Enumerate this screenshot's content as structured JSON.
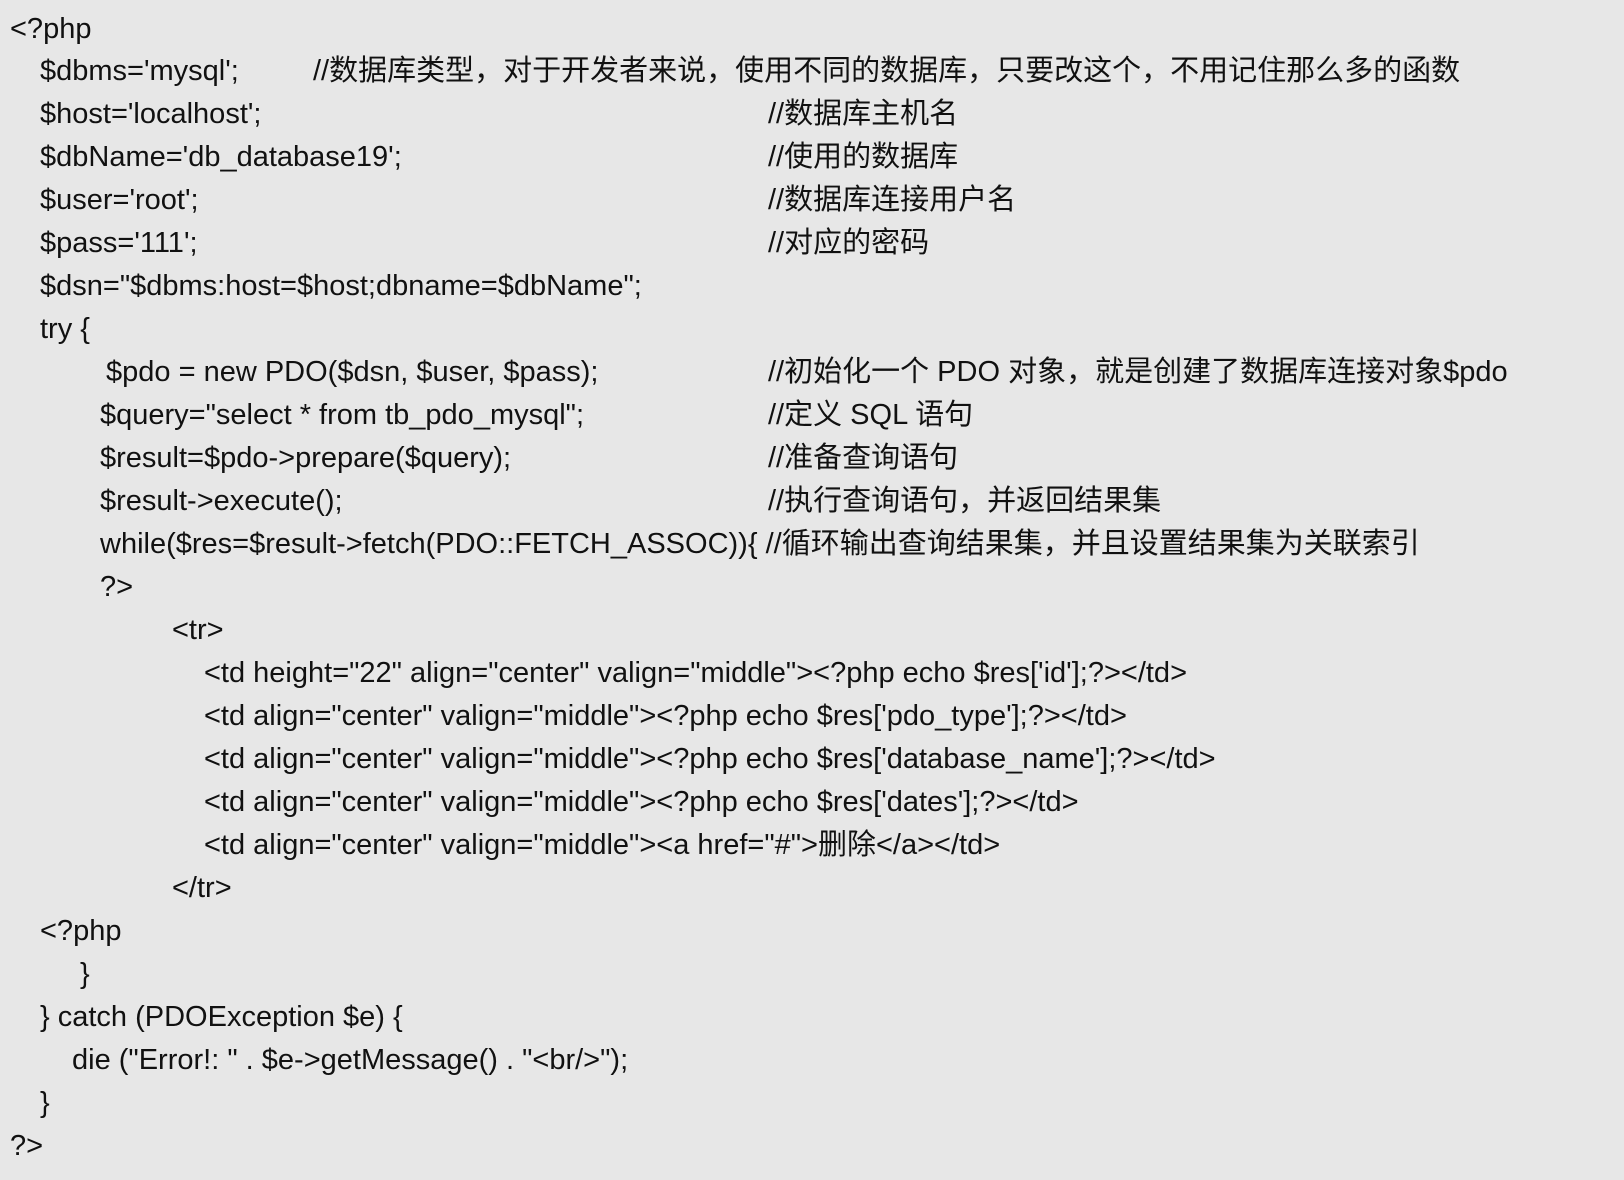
{
  "code": {
    "lines": [
      "<?php",
      "$dbms='mysql';",
      "$host='localhost';",
      "$dbName='db_database19';",
      "$user='root';",
      "$pass='111';",
      "$dsn=\"$dbms:host=$host;dbname=$dbName\";",
      "try {",
      "$pdo = new PDO($dsn, $user, $pass);",
      "$query=\"select * from tb_pdo_mysql\";",
      "$result=$pdo->prepare($query);",
      "$result->execute();",
      "while($res=$result->fetch(PDO::FETCH_ASSOC)){ //循环输出查询结果集，并且设置结果集为关联索引",
      "?>",
      "<tr>",
      "<td height=\"22\" align=\"center\" valign=\"middle\"><?php echo $res['id'];?></td>",
      "<td align=\"center\" valign=\"middle\"><?php echo $res['pdo_type'];?></td>",
      "<td align=\"center\" valign=\"middle\"><?php echo $res['database_name'];?></td>",
      "<td align=\"center\" valign=\"middle\"><?php echo $res['dates'];?></td>",
      "<td align=\"center\" valign=\"middle\"><a href=\"#\">删除</a></td>",
      "</tr>",
      "<?php",
      "}",
      "} catch (PDOException $e) {",
      "die (\"Error!: \" . $e->getMessage() . \"<br/>\");",
      "}",
      "?>"
    ],
    "comments": {
      "dbms": "//数据库类型，对于开发者来说，使用不同的数据库，只要改这个，不用记住那么多的函数",
      "host": "//数据库主机名",
      "dbName": "//使用的数据库",
      "user": "//数据库连接用户名",
      "pass": "//对应的密码",
      "pdo": "//初始化一个 PDO 对象，就是创建了数据库连接对象$pdo",
      "query": "//定义 SQL 语句",
      "prepare": "//准备查询语句",
      "execute": "//执行查询语句，并返回结果集"
    }
  }
}
